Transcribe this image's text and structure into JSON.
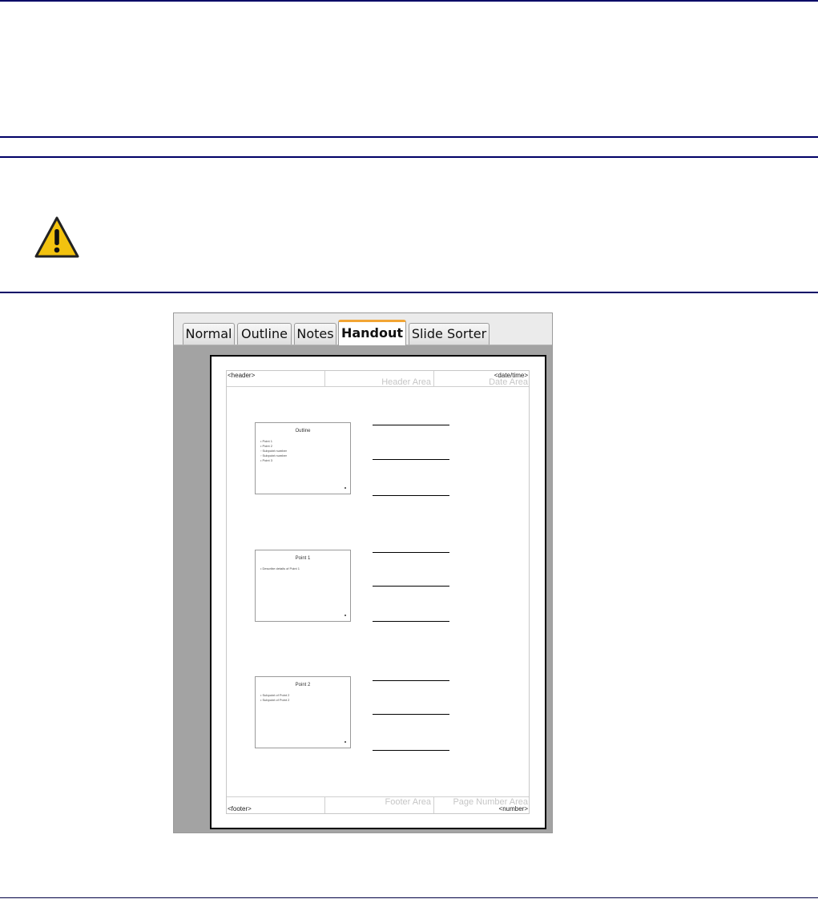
{
  "tabs": [
    "Normal",
    "Outline",
    "Notes",
    "Handout",
    "Slide Sorter"
  ],
  "active_tab": "Handout",
  "handout": {
    "header_field": "<header>",
    "datetime_field": "<date/time>",
    "header_area": "Header Area",
    "date_area": "Date Area",
    "footer_area": "Footer Area",
    "page_number_area": "Page Number Area",
    "footer_field": "<footer>",
    "number_field": "<number>"
  },
  "slides": [
    {
      "title": "Outline",
      "lines": [
        "• Point 1",
        "• Point 2",
        "   ◦ Subpoint number",
        "   ◦ Subpoint number",
        "• Point 3"
      ]
    },
    {
      "title": "Point 1",
      "lines": [
        "• Describe details of Point 1"
      ]
    },
    {
      "title": "Point 2",
      "lines": [
        "• Subpoint of Point 2",
        "• Subpoint of Point 2"
      ]
    }
  ],
  "icons": {
    "warning": "warning-icon"
  },
  "colors": {
    "rule": "#000066",
    "active_tab_accent": "#f2a534",
    "warning_fill": "#f2c20f"
  }
}
